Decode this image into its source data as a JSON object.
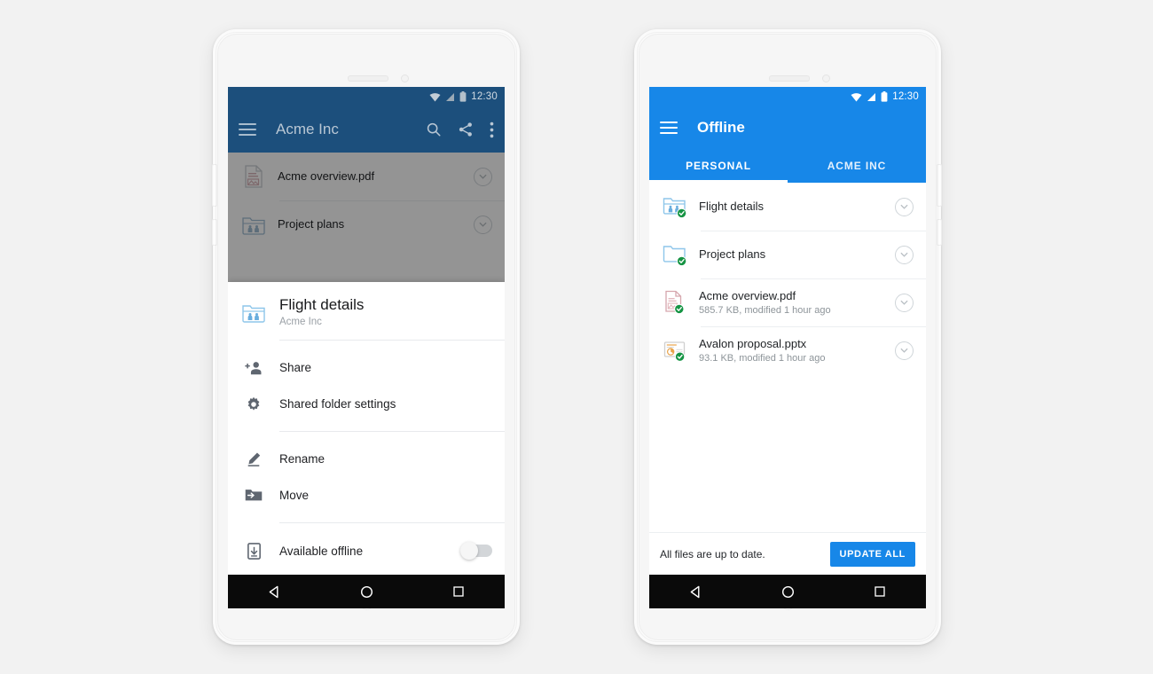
{
  "colors": {
    "background": "#f2f2f2",
    "accent_blue": "#1787e8",
    "scrimmed_blue": "#1c4f7c",
    "scrim": "rgba(0,0,0,0.42)",
    "nav_bar": "#0a0a0a",
    "offline_badge_green": "#169444",
    "folder_blue": "#8ec6ea",
    "pdf_red": "#e8a0a8"
  },
  "left_phone": {
    "status_bar": {
      "time": "12:30",
      "icons": [
        "wifi-icon",
        "signal-icon",
        "battery-icon"
      ]
    },
    "app_bar": {
      "menu_icon": "hamburger-icon",
      "title": "Acme Inc",
      "actions": [
        "search-icon",
        "share-icon",
        "overflow-menu-icon"
      ]
    },
    "background_list": [
      {
        "icon": "pdf-file-icon",
        "title": "Acme overview.pdf",
        "chevron": "chevron-down-icon"
      },
      {
        "icon": "shared-folder-icon",
        "title": "Project plans",
        "chevron": "chevron-down-icon"
      }
    ],
    "bottom_sheet": {
      "header": {
        "icon": "shared-folder-icon",
        "title": "Flight details",
        "subtitle": "Acme Inc"
      },
      "groups": [
        {
          "items": [
            {
              "icon": "person-add-icon",
              "label": "Share",
              "type": "action"
            },
            {
              "icon": "gear-icon",
              "label": "Shared folder settings",
              "type": "action"
            }
          ]
        },
        {
          "items": [
            {
              "icon": "pencil-icon",
              "label": "Rename",
              "type": "action"
            },
            {
              "icon": "move-folder-icon",
              "label": "Move",
              "type": "action"
            }
          ]
        },
        {
          "items": [
            {
              "icon": "phone-download-icon",
              "label": "Available offline",
              "type": "toggle",
              "toggle_on": false
            }
          ]
        }
      ]
    },
    "nav_bar": {
      "keys": [
        "back-icon",
        "home-icon",
        "recents-icon"
      ]
    }
  },
  "right_phone": {
    "status_bar": {
      "time": "12:30",
      "icons": [
        "wifi-icon",
        "signal-icon",
        "battery-icon"
      ]
    },
    "app_bar": {
      "menu_icon": "hamburger-icon",
      "title": "Offline"
    },
    "tabs": [
      {
        "label": "PERSONAL",
        "active": true
      },
      {
        "label": "ACME INC",
        "active": false
      }
    ],
    "files": [
      {
        "icon": "shared-folder-icon",
        "badge": "offline-check-badge",
        "title": "Flight details",
        "subtitle": "",
        "chevron": "chevron-down-icon"
      },
      {
        "icon": "folder-icon",
        "badge": "offline-check-badge",
        "title": "Project plans",
        "subtitle": "",
        "chevron": "chevron-down-icon"
      },
      {
        "icon": "pdf-file-icon",
        "badge": "offline-check-badge",
        "title": "Acme overview.pdf",
        "subtitle": "585.7 KB, modified 1 hour ago",
        "chevron": "chevron-down-icon"
      },
      {
        "icon": "pptx-file-icon",
        "badge": "offline-check-badge",
        "title": "Avalon proposal.pptx",
        "subtitle": "93.1 KB, modified 1 hour ago",
        "chevron": "chevron-down-icon"
      }
    ],
    "update_bar": {
      "status_text": "All files are up to date.",
      "button_label": "UPDATE ALL"
    },
    "nav_bar": {
      "keys": [
        "back-icon",
        "home-icon",
        "recents-icon"
      ]
    }
  }
}
